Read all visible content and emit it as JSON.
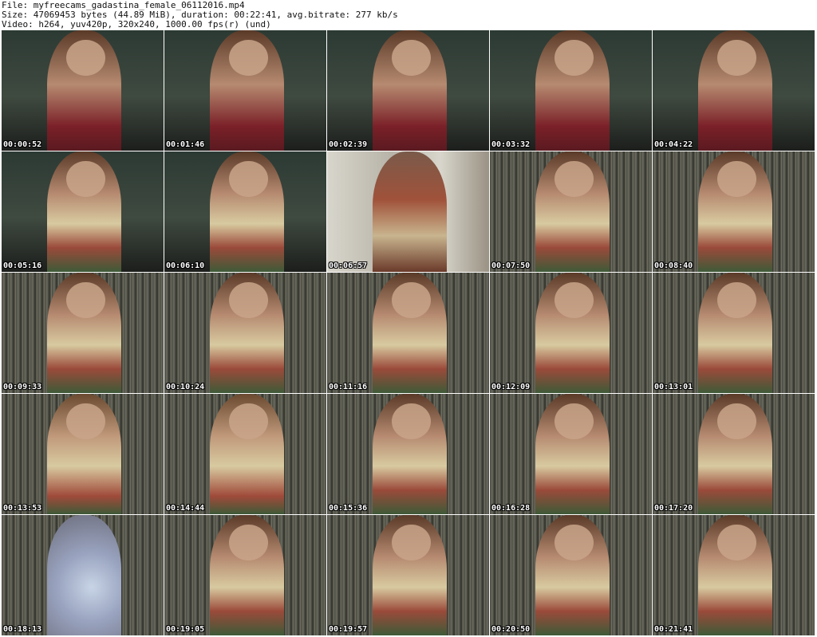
{
  "header": {
    "file_line": "File: myfreecams_gadastina_female_06112016.mp4",
    "size_line": "Size: 47069453 bytes (44.89 MiB), duration: 00:22:41, avg.bitrate: 277 kb/s",
    "video_line": "Video: h264, yuv420p, 320x240, 1000.00 fps(r) (und)"
  },
  "thumbnails": [
    {
      "time": "00:00:52"
    },
    {
      "time": "00:01:46"
    },
    {
      "time": "00:02:39"
    },
    {
      "time": "00:03:32"
    },
    {
      "time": "00:04:22"
    },
    {
      "time": "00:05:16"
    },
    {
      "time": "00:06:10"
    },
    {
      "time": "00:06:57"
    },
    {
      "time": "00:07:50"
    },
    {
      "time": "00:08:40"
    },
    {
      "time": "00:09:33"
    },
    {
      "time": "00:10:24"
    },
    {
      "time": "00:11:16"
    },
    {
      "time": "00:12:09"
    },
    {
      "time": "00:13:01"
    },
    {
      "time": "00:13:53"
    },
    {
      "time": "00:14:44"
    },
    {
      "time": "00:15:36"
    },
    {
      "time": "00:16:28"
    },
    {
      "time": "00:17:20"
    },
    {
      "time": "00:18:13"
    },
    {
      "time": "00:19:05"
    },
    {
      "time": "00:19:57"
    },
    {
      "time": "00:20:50"
    },
    {
      "time": "00:21:41"
    }
  ]
}
